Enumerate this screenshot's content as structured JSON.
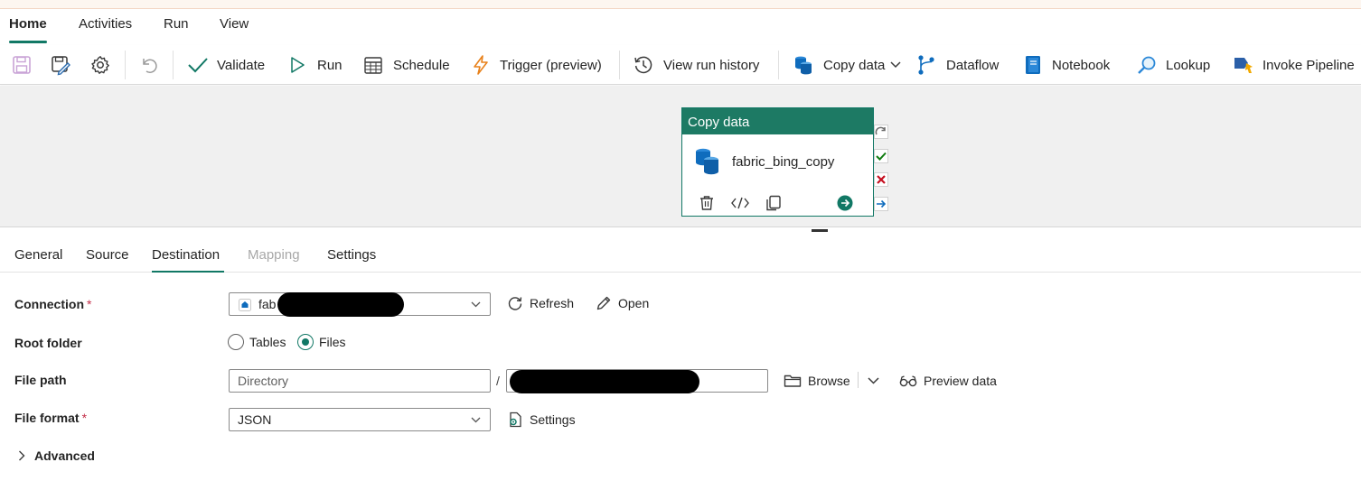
{
  "menu": {
    "tabs": [
      "Home",
      "Activities",
      "Run",
      "View"
    ],
    "active_tab": "Home"
  },
  "toolbar": {
    "validate": "Validate",
    "run": "Run",
    "schedule": "Schedule",
    "trigger": "Trigger (preview)",
    "view_run_history": "View run history",
    "copy_data": "Copy data",
    "dataflow": "Dataflow",
    "notebook": "Notebook",
    "lookup": "Lookup",
    "invoke_pipeline": "Invoke Pipeline"
  },
  "activity": {
    "type": "Copy data",
    "name": "fabric_bing_copy"
  },
  "panel_tabs": {
    "general": "General",
    "source": "Source",
    "destination": "Destination",
    "mapping": "Mapping",
    "settings": "Settings",
    "active": "Destination"
  },
  "destination": {
    "connection_label": "Connection",
    "connection_value": "fab",
    "refresh": "Refresh",
    "open": "Open",
    "root_folder_label": "Root folder",
    "root_options": [
      "Tables",
      "Files"
    ],
    "root_selected": "Files",
    "file_path_label": "File path",
    "directory_placeholder": "Directory",
    "path_separator": "/",
    "browse": "Browse",
    "preview_data": "Preview data",
    "file_format_label": "File format",
    "file_format_value": "JSON",
    "format_settings": "Settings",
    "advanced": "Advanced",
    "required_marker": "*"
  },
  "colors": {
    "accent": "#117865",
    "activity_header": "#1d7a64",
    "required": "#c4314b"
  }
}
